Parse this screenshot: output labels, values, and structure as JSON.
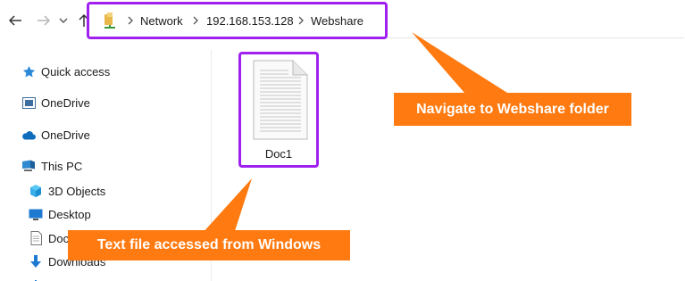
{
  "address_bar": {
    "crumbs": [
      "Network",
      "192.168.153.128",
      "Webshare"
    ]
  },
  "sidebar": {
    "items": [
      {
        "label": "Quick access",
        "icon": "star-icon"
      },
      {
        "label": "OneDrive",
        "icon": "onedrive-folder-icon"
      },
      {
        "label": "OneDrive",
        "icon": "cloud-icon"
      },
      {
        "label": "This PC",
        "icon": "pc-icon"
      },
      {
        "label": "3D Objects",
        "icon": "cube-icon"
      },
      {
        "label": "Desktop",
        "icon": "desktop-icon"
      },
      {
        "label": "Documents",
        "icon": "document-icon"
      },
      {
        "label": "Downloads",
        "icon": "download-icon"
      }
    ]
  },
  "files": [
    {
      "name": "Doc1",
      "icon": "text-file-icon"
    }
  ],
  "callouts": {
    "navigate": "Navigate to Webshare folder",
    "text_file": "Text file accessed from Windows"
  },
  "colors": {
    "highlight": "#a020f0",
    "callout": "#ff7a10",
    "accent": "#0078d4"
  }
}
